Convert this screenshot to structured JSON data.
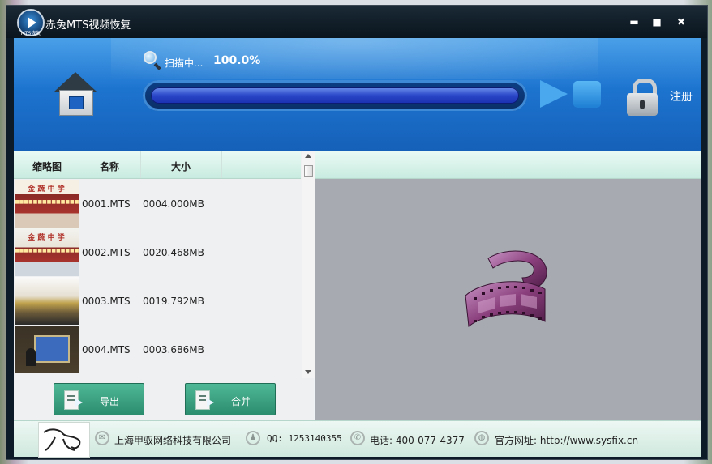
{
  "window": {
    "title": "赤兔MTS视频恢复",
    "logo_text": "MTS恢复",
    "min_label": "▬",
    "max_label": "■",
    "close_label": "✖"
  },
  "scan": {
    "label": "扫描中...",
    "percent_text": "100.0%",
    "progress": 1.0
  },
  "register_label": "注册",
  "list": {
    "headers": [
      "缩略图",
      "名称",
      "大小"
    ],
    "rows": [
      {
        "name": "0001.MTS",
        "size": "0004.000MB"
      },
      {
        "name": "0002.MTS",
        "size": "0020.468MB"
      },
      {
        "name": "0003.MTS",
        "size": "0019.792MB"
      },
      {
        "name": "0004.MTS",
        "size": "0003.686MB"
      }
    ]
  },
  "buttons": {
    "export_label": "导出",
    "merge_label": "合并"
  },
  "footer": {
    "company": "上海甲驭网络科技有限公司",
    "qq": "QQ: 1253140355",
    "phone": "电话: 400-077-4377",
    "website": "官方网址: http://www.sysfix.cn"
  },
  "colors": {
    "header_blue": "#1d74cf",
    "button_green": "#2b8d6e",
    "preview_gray": "#a7aab1"
  },
  "icons": [
    "app-logo-icon",
    "home-icon",
    "search-icon",
    "play-icon",
    "stop-icon",
    "lock-icon",
    "export-icon",
    "merge-icon",
    "film-reel-icon",
    "company-icon",
    "qq-icon",
    "phone-icon",
    "globe-icon"
  ]
}
